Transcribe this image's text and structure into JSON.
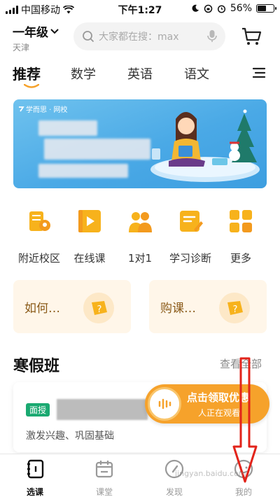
{
  "status_bar": {
    "carrier": "中国移动",
    "time": "下午1:27",
    "battery": "56%",
    "battery_level": 0.56
  },
  "header": {
    "grade": "一年级",
    "city": "天津",
    "search_placeholder": "大家都在搜：max"
  },
  "tabs": [
    "推荐",
    "数学",
    "英语",
    "语文"
  ],
  "banner": {
    "brand": "学而思 · 网校"
  },
  "quick_links": [
    "附近校区",
    "在线课",
    "1对1",
    "学习诊断",
    "更多"
  ],
  "cards": [
    "如何…",
    "购课…"
  ],
  "section": {
    "title": "寒假班",
    "more": "查看全部"
  },
  "course": {
    "badge": "面授",
    "desc": "激发兴趣、巩固基础"
  },
  "promo": {
    "title": "点击领取优惠",
    "sub": "人正在观看"
  },
  "bottom_nav": [
    "选课",
    "课堂",
    "发现",
    "我的"
  ],
  "watermark": "jingyan.baidu.com",
  "colors": {
    "accent": "#f6a22b",
    "badge": "#1aa971",
    "arrow": "#e2231a",
    "card_bg": "#fff6e9"
  }
}
